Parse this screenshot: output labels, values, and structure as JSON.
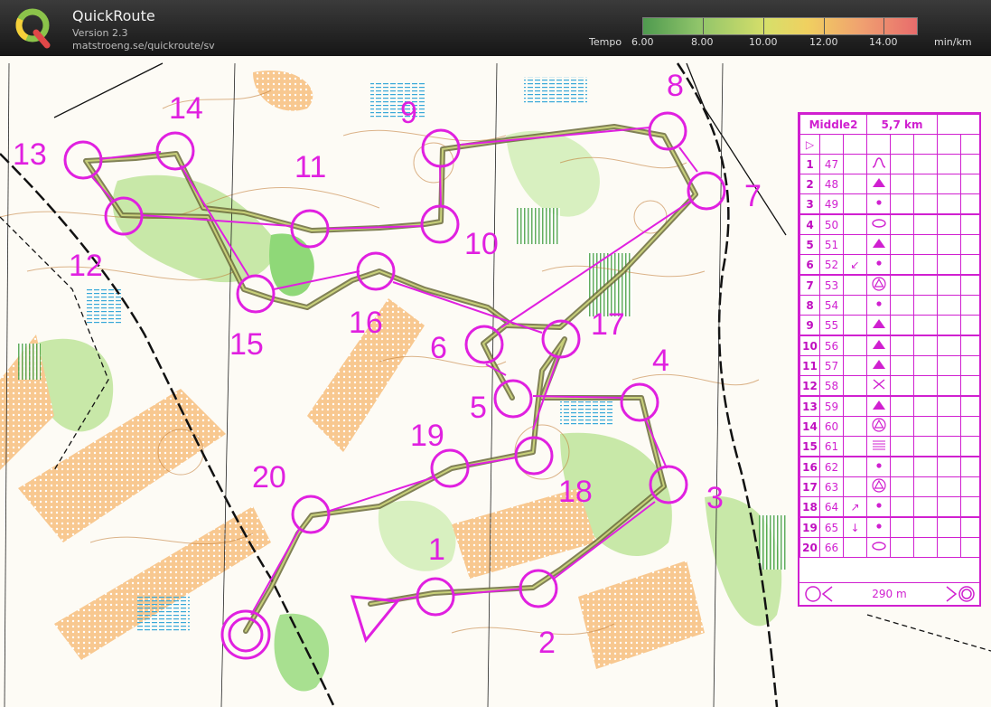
{
  "app": {
    "title": "QuickRoute",
    "version": "Version 2.3",
    "url": "matstroeng.se/quickroute/sv"
  },
  "legend": {
    "label": "Tempo",
    "ticks": [
      "6.00",
      "8.00",
      "10.00",
      "12.00",
      "14.00"
    ],
    "unit": "min/km"
  },
  "colors": {
    "course": "#e020e0",
    "route": "#6b6b3a",
    "header_bg": "#2a2a2a"
  },
  "map": {
    "controls": [
      {
        "label": "1"
      },
      {
        "label": "2"
      },
      {
        "label": "3"
      },
      {
        "label": "4"
      },
      {
        "label": "5"
      },
      {
        "label": "6"
      },
      {
        "label": "7"
      },
      {
        "label": "8"
      },
      {
        "label": "9"
      },
      {
        "label": "10"
      },
      {
        "label": "11"
      },
      {
        "label": "12"
      },
      {
        "label": "13"
      },
      {
        "label": "14"
      },
      {
        "label": "15"
      },
      {
        "label": "16"
      },
      {
        "label": "17"
      },
      {
        "label": "18"
      },
      {
        "label": "19"
      },
      {
        "label": "20"
      }
    ]
  },
  "description": {
    "course_name": "Middle2",
    "length": "5,7 km",
    "rows": [
      {
        "num": "1",
        "code": "47",
        "dir": "",
        "symbol": "knoll-icon"
      },
      {
        "num": "2",
        "code": "48",
        "dir": "",
        "symbol": "boulder-icon"
      },
      {
        "num": "3",
        "code": "49",
        "dir": "",
        "symbol": "dot-icon"
      },
      {
        "num": "4",
        "code": "50",
        "dir": "",
        "symbol": "ellipse-icon"
      },
      {
        "num": "5",
        "code": "51",
        "dir": "",
        "symbol": "boulder-icon"
      },
      {
        "num": "6",
        "code": "52",
        "dir": "↙",
        "symbol": "dot-icon"
      },
      {
        "num": "7",
        "code": "53",
        "dir": "",
        "symbol": "triangle-circle-icon"
      },
      {
        "num": "8",
        "code": "54",
        "dir": "",
        "symbol": "dot-icon"
      },
      {
        "num": "9",
        "code": "55",
        "dir": "",
        "symbol": "boulder-icon"
      },
      {
        "num": "10",
        "code": "56",
        "dir": "",
        "symbol": "boulder-icon"
      },
      {
        "num": "11",
        "code": "57",
        "dir": "",
        "symbol": "boulder-icon"
      },
      {
        "num": "12",
        "code": "58",
        "dir": "",
        "symbol": "cross-icon"
      },
      {
        "num": "13",
        "code": "59",
        "dir": "",
        "symbol": "boulder-icon"
      },
      {
        "num": "14",
        "code": "60",
        "dir": "",
        "symbol": "triangle-circle-icon"
      },
      {
        "num": "15",
        "code": "61",
        "dir": "",
        "symbol": "lines-icon"
      },
      {
        "num": "16",
        "code": "62",
        "dir": "",
        "symbol": "dot-icon"
      },
      {
        "num": "17",
        "code": "63",
        "dir": "",
        "symbol": "triangle-circle-icon"
      },
      {
        "num": "18",
        "code": "64",
        "dir": "↗",
        "symbol": "dot-icon"
      },
      {
        "num": "19",
        "code": "65",
        "dir": "↓",
        "symbol": "dot-icon"
      },
      {
        "num": "20",
        "code": "66",
        "dir": "",
        "symbol": "ellipse-icon"
      }
    ],
    "finish_distance": "290 m"
  }
}
